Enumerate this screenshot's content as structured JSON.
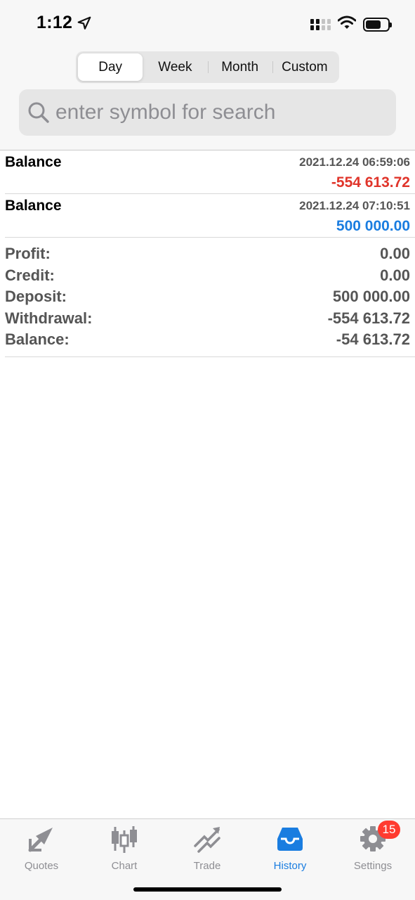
{
  "status_bar": {
    "time": "1:12"
  },
  "period_tabs": [
    {
      "label": "Day",
      "active": true
    },
    {
      "label": "Week",
      "active": false
    },
    {
      "label": "Month",
      "active": false
    },
    {
      "label": "Custom",
      "active": false
    }
  ],
  "search": {
    "placeholder": "enter symbol for search",
    "value": ""
  },
  "history": [
    {
      "type": "Balance",
      "time": "2021.12.24 06:59:06",
      "amount": "-554 613.72",
      "sign": "negative"
    },
    {
      "type": "Balance",
      "time": "2021.12.24 07:10:51",
      "amount": "500 000.00",
      "sign": "positive"
    }
  ],
  "summary": [
    {
      "label": "Profit:",
      "value": "0.00"
    },
    {
      "label": "Credit:",
      "value": "0.00"
    },
    {
      "label": "Deposit:",
      "value": "500 000.00"
    },
    {
      "label": "Withdrawal:",
      "value": "-554 613.72"
    },
    {
      "label": "Balance:",
      "value": "-54 613.72"
    }
  ],
  "tabbar": [
    {
      "label": "Quotes",
      "icon": "quotes-icon",
      "active": false
    },
    {
      "label": "Chart",
      "icon": "chart-icon",
      "active": false
    },
    {
      "label": "Trade",
      "icon": "trade-icon",
      "active": false
    },
    {
      "label": "History",
      "icon": "history-icon",
      "active": true
    },
    {
      "label": "Settings",
      "icon": "settings-icon",
      "active": false,
      "badge": "15"
    }
  ],
  "colors": {
    "accent": "#1a7de0",
    "negative": "#e0352b",
    "badge": "#ff3b30"
  }
}
